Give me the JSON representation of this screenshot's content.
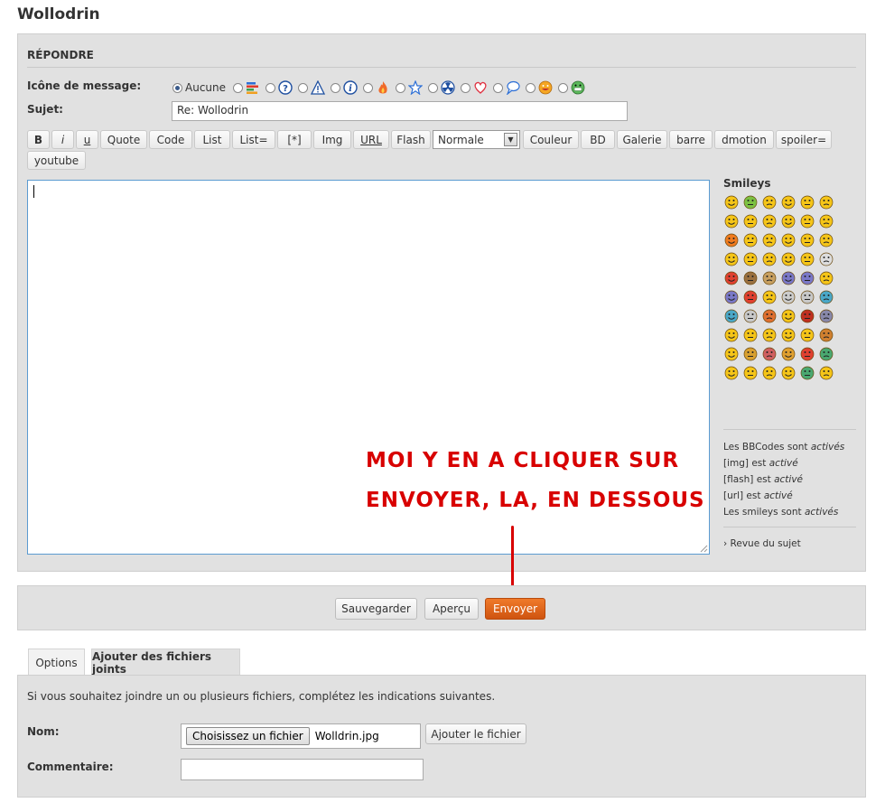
{
  "page": {
    "title": "Wollodrin"
  },
  "reply": {
    "heading": "RÉPONDRE",
    "icon_label": "Icône de message:",
    "icon_none": "Aucune",
    "icons": [
      "chart-icon",
      "question-icon",
      "warning-icon",
      "info-icon",
      "flame-icon",
      "star-icon",
      "radiation-icon",
      "heart-icon",
      "speech-bubble-icon",
      "orange-smiley-icon",
      "grin-smiley-icon"
    ],
    "subject_label": "Sujet:",
    "subject_value": "Re: Wollodrin"
  },
  "toolbar": {
    "buttons": [
      "B",
      "i",
      "u",
      "Quote",
      "Code",
      "List",
      "List=",
      "[*]",
      "Img",
      "URL",
      "Flash"
    ],
    "font_size_value": "Normale",
    "buttons2": [
      "Couleur",
      "BD",
      "Galerie",
      "barre",
      "dmotion",
      "spoiler="
    ],
    "buttons3": [
      "youtube"
    ]
  },
  "smileys": {
    "title": "Smileys",
    "colors": [
      "#f5c518",
      "#7cc142",
      "#f5c518",
      "#f5c518",
      "#f5c518",
      "#f5c518",
      "#f5c518",
      "#f5c518",
      "#f5c518",
      "#f5c518",
      "#f5c518",
      "#f5c518",
      "#f07b1e",
      "#f5c518",
      "#f5c518",
      "#f5c518",
      "#f5c518",
      "#f5c518",
      "#f5c518",
      "#f5c518",
      "#f5c518",
      "#f5c518",
      "#f5c518",
      "#dddddd",
      "#e04030",
      "#9a7040",
      "#c8a060",
      "#7a78c8",
      "#7a78c8",
      "#f5c518",
      "#7a78c8",
      "#e04030",
      "#f5c518",
      "#cccccc",
      "#c8c8c8",
      "#4aa8c8",
      "#4aa8c8",
      "#c8c8c8",
      "#e07030",
      "#f5c518",
      "#c03020",
      "#8888aa",
      "#f5c518",
      "#f5c518",
      "#f5c518",
      "#f5c518",
      "#f5c518",
      "#d08030",
      "#f5c518",
      "#d8a030",
      "#d06060",
      "#e0a030",
      "#e04030",
      "#4aa870",
      "#f5c518",
      "#f5c518",
      "#f5c518",
      "#f5c518",
      "#4aa870",
      "#f5c518"
    ]
  },
  "bbcode_info": {
    "line1_prefix": "Les BBCodes sont ",
    "line1_status": "activés",
    "line2_prefix": "[img] est ",
    "line2_status": "activé",
    "line3_prefix": "[flash] est ",
    "line3_status": "activé",
    "line4_prefix": "[url] est ",
    "line4_status": "activé",
    "line5_prefix": "Les smileys sont ",
    "line5_status": "activés",
    "review_link": "› Revue du sujet"
  },
  "annotation": {
    "line1": "MOI Y EN A CLIQUER SUR",
    "line2": "ENVOYER, LA, EN DESSOUS",
    "color": "#d80000"
  },
  "actions": {
    "save": "Sauvegarder",
    "preview": "Aperçu",
    "send": "Envoyer"
  },
  "tabs": [
    "Options",
    "Ajouter des fichiers joints"
  ],
  "attachments": {
    "intro": "Si vous souhaitez joindre un ou plusieurs fichiers, complétez les indications suivantes.",
    "name_label": "Nom:",
    "choose_button": "Choisissez un fichier",
    "file_name": "Wolldrin.jpg",
    "add_button": "Ajouter le fichier",
    "comment_label": "Commentaire:"
  }
}
